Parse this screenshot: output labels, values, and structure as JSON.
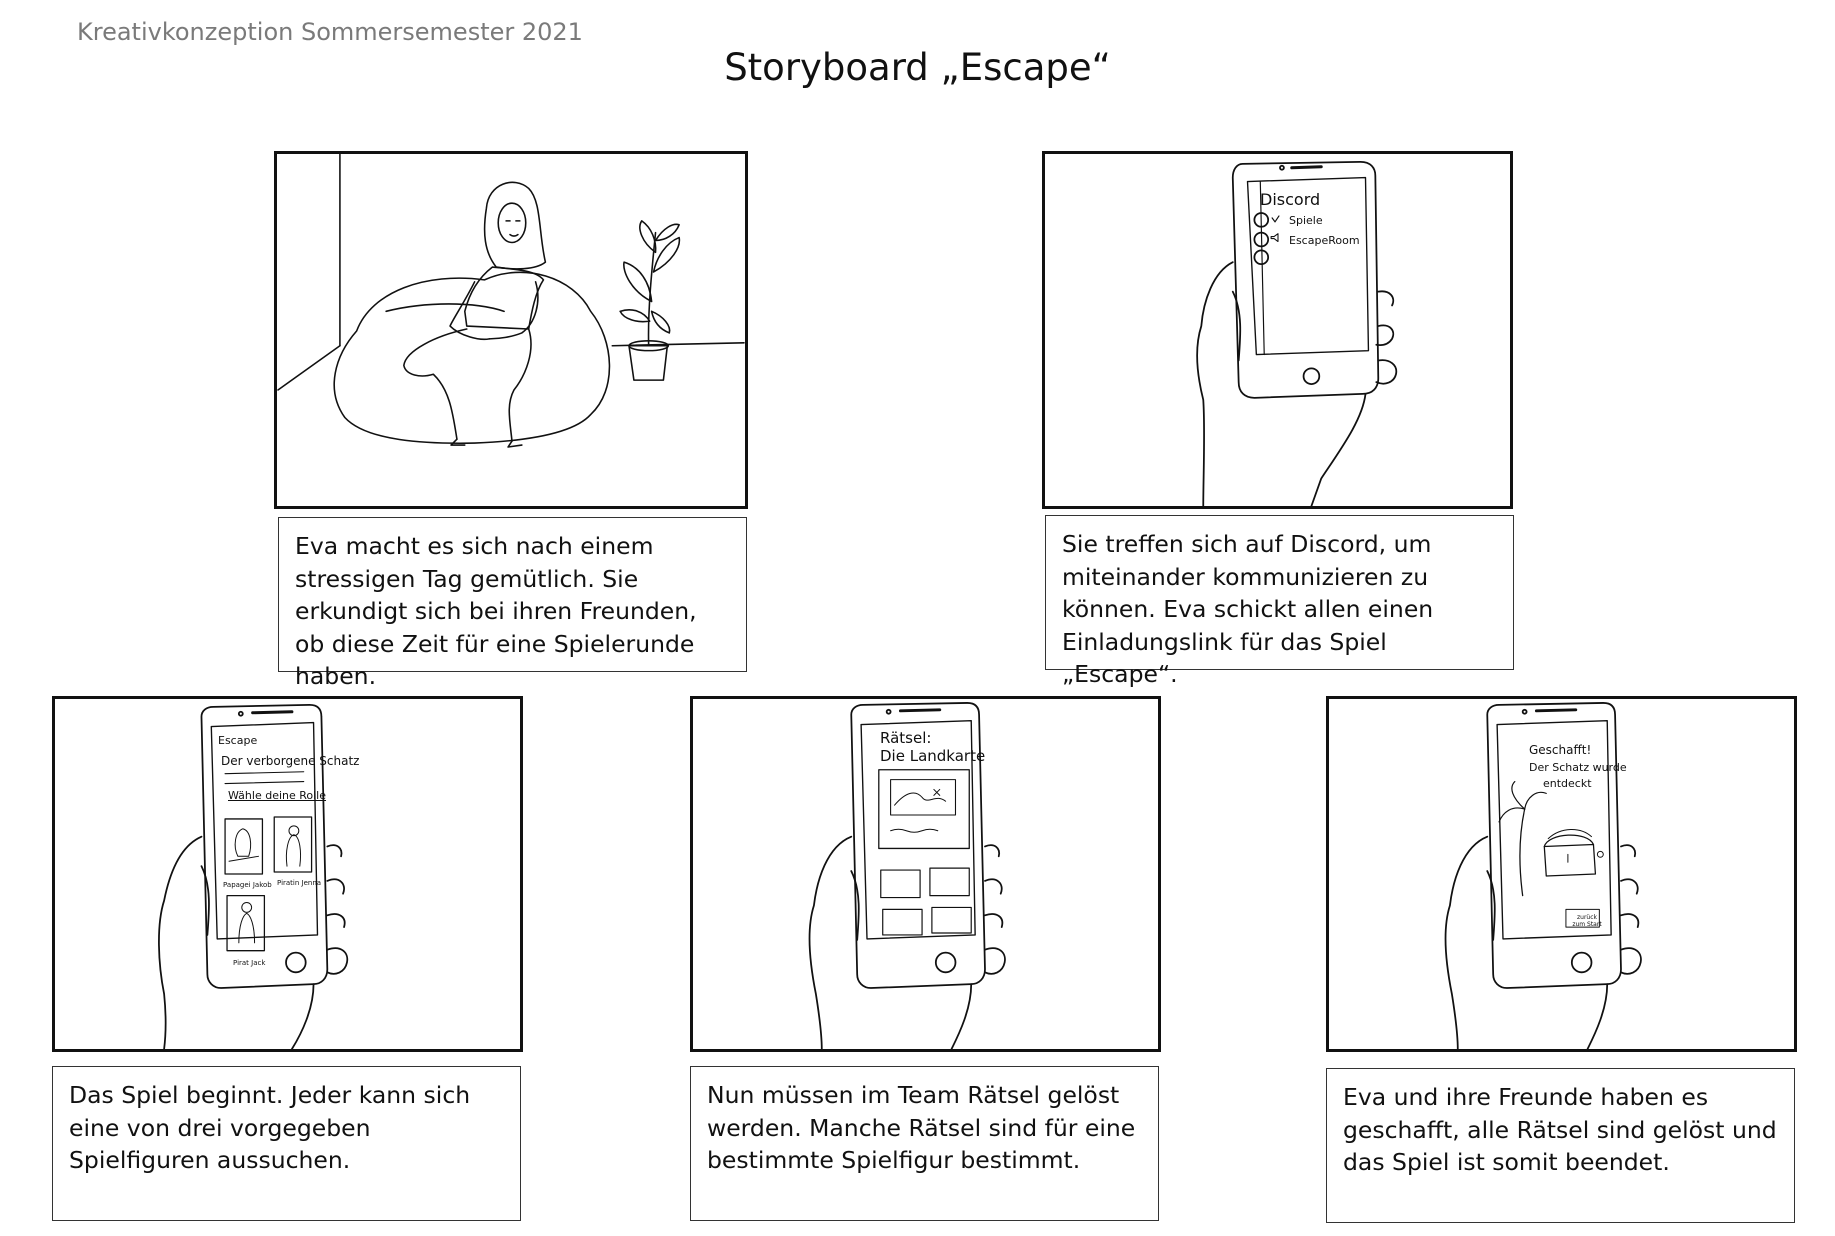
{
  "header": {
    "course": "Kreativkonzeption Sommersemester 2021",
    "title": "Storyboard „Escape“"
  },
  "panels": [
    {
      "caption": "Eva macht es sich nach einem stressigen Tag gemütlich. Sie erkundigt sich bei ihren Freunden, ob diese Zeit für eine Spielerunde haben."
    },
    {
      "caption": "Sie treffen sich auf Discord, um miteinander kommunizieren zu können. Eva schickt allen einen Einladungslink für das Spiel „Escape“.",
      "screen": {
        "app": "Discord",
        "items": [
          "Spiele",
          "EscapeRoom"
        ]
      }
    },
    {
      "caption": "Das Spiel beginnt. Jeder kann sich eine von drei vorgegeben Spielfiguren aussuchen.",
      "screen": {
        "app": "Escape",
        "heading": "Der verborgene Schatz",
        "subheading": "Wähle deine Rolle",
        "roles": [
          "Papagei Jakob",
          "Piratin Jenna",
          "Pirat Jack"
        ]
      }
    },
    {
      "caption": "Nun müssen im Team Rätsel gelöst werden. Manche Rätsel sind für eine bestimmte Spielfigur bestimmt.",
      "screen": {
        "heading_line1": "Rätsel:",
        "heading_line2": "Die Landkarte"
      }
    },
    {
      "caption": "Eva und ihre Freunde haben es geschafft, alle Rätsel sind gelöst und das Spiel ist somit beendet.",
      "screen": {
        "line1": "Geschafft!",
        "line2": "Der Schatz wurde",
        "line3": "entdeckt",
        "button_line1": "zurück",
        "button_line2": "zum Start"
      }
    }
  ]
}
